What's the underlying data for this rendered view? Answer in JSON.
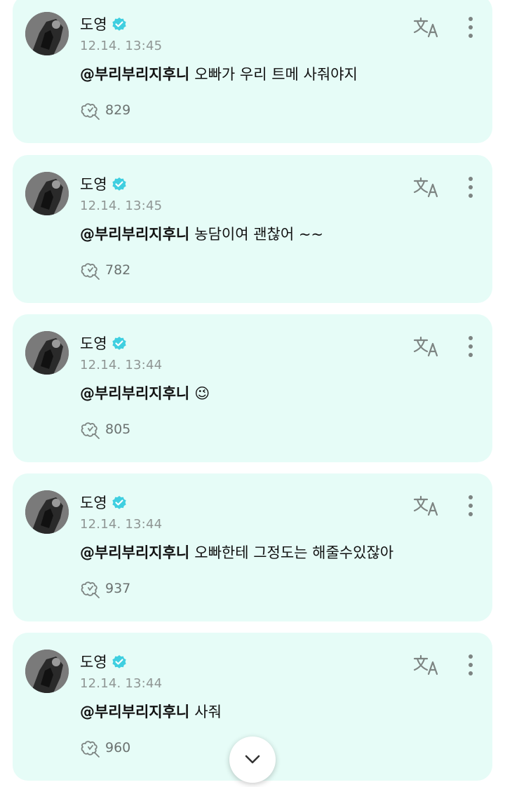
{
  "colors": {
    "card_bg": "#e6fcf7",
    "verified": "#3fcfe0",
    "text": "#111111",
    "muted": "#8f9694"
  },
  "icons": {
    "verified": "verified-badge-icon",
    "translate": "translate-icon",
    "more": "more-vertical-icon",
    "like": "like-icon",
    "scroll": "chevron-down-icon"
  },
  "posts": [
    {
      "author": "도영",
      "time": "12.14. 13:45",
      "mention": "@부리부리지후니",
      "text": "오빠가 우리 트메 사줘야지",
      "likes": "829"
    },
    {
      "author": "도영",
      "time": "12.14. 13:45",
      "mention": "@부리부리지후니",
      "text": "농담이여 괜찮어 ~~",
      "likes": "782"
    },
    {
      "author": "도영",
      "time": "12.14. 13:44",
      "mention": "@부리부리지후니",
      "text": "😉",
      "likes": "805"
    },
    {
      "author": "도영",
      "time": "12.14. 13:44",
      "mention": "@부리부리지후니",
      "text": "오빠한테 그정도는 해줄수있잖아",
      "likes": "937"
    },
    {
      "author": "도영",
      "time": "12.14. 13:44",
      "mention": "@부리부리지후니",
      "text": "사줘",
      "likes": "960"
    }
  ]
}
